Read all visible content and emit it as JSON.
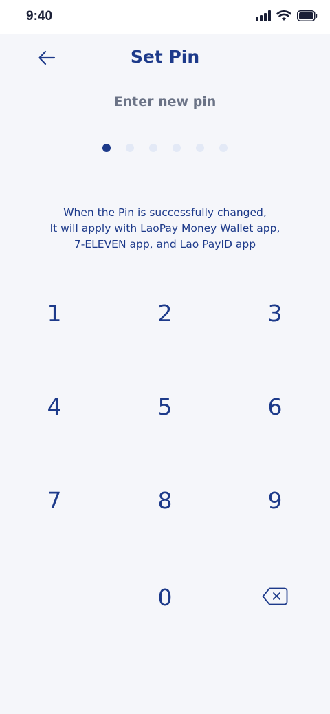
{
  "status_bar": {
    "time": "9:40",
    "icons": [
      "signal-icon",
      "wifi-icon",
      "battery-icon"
    ]
  },
  "header": {
    "title": "Set Pin",
    "back_icon": "arrow-left-icon"
  },
  "subtitle": "Enter new pin",
  "pin": {
    "length": 6,
    "filled": 1
  },
  "info": {
    "line1": "When the Pin is successfully changed,",
    "line2": "It will apply with LaoPay Money Wallet app,",
    "line3": "7-ELEVEN app, and Lao PayID app"
  },
  "keypad": {
    "k1": "1",
    "k2": "2",
    "k3": "3",
    "k4": "4",
    "k5": "5",
    "k6": "6",
    "k7": "7",
    "k8": "8",
    "k9": "9",
    "k0": "0",
    "delete_icon": "backspace-icon"
  },
  "colors": {
    "primary": "#1d3a8a",
    "muted": "#6b7386",
    "background": "#f5f6fa",
    "dot_empty": "#e3e9f6"
  }
}
